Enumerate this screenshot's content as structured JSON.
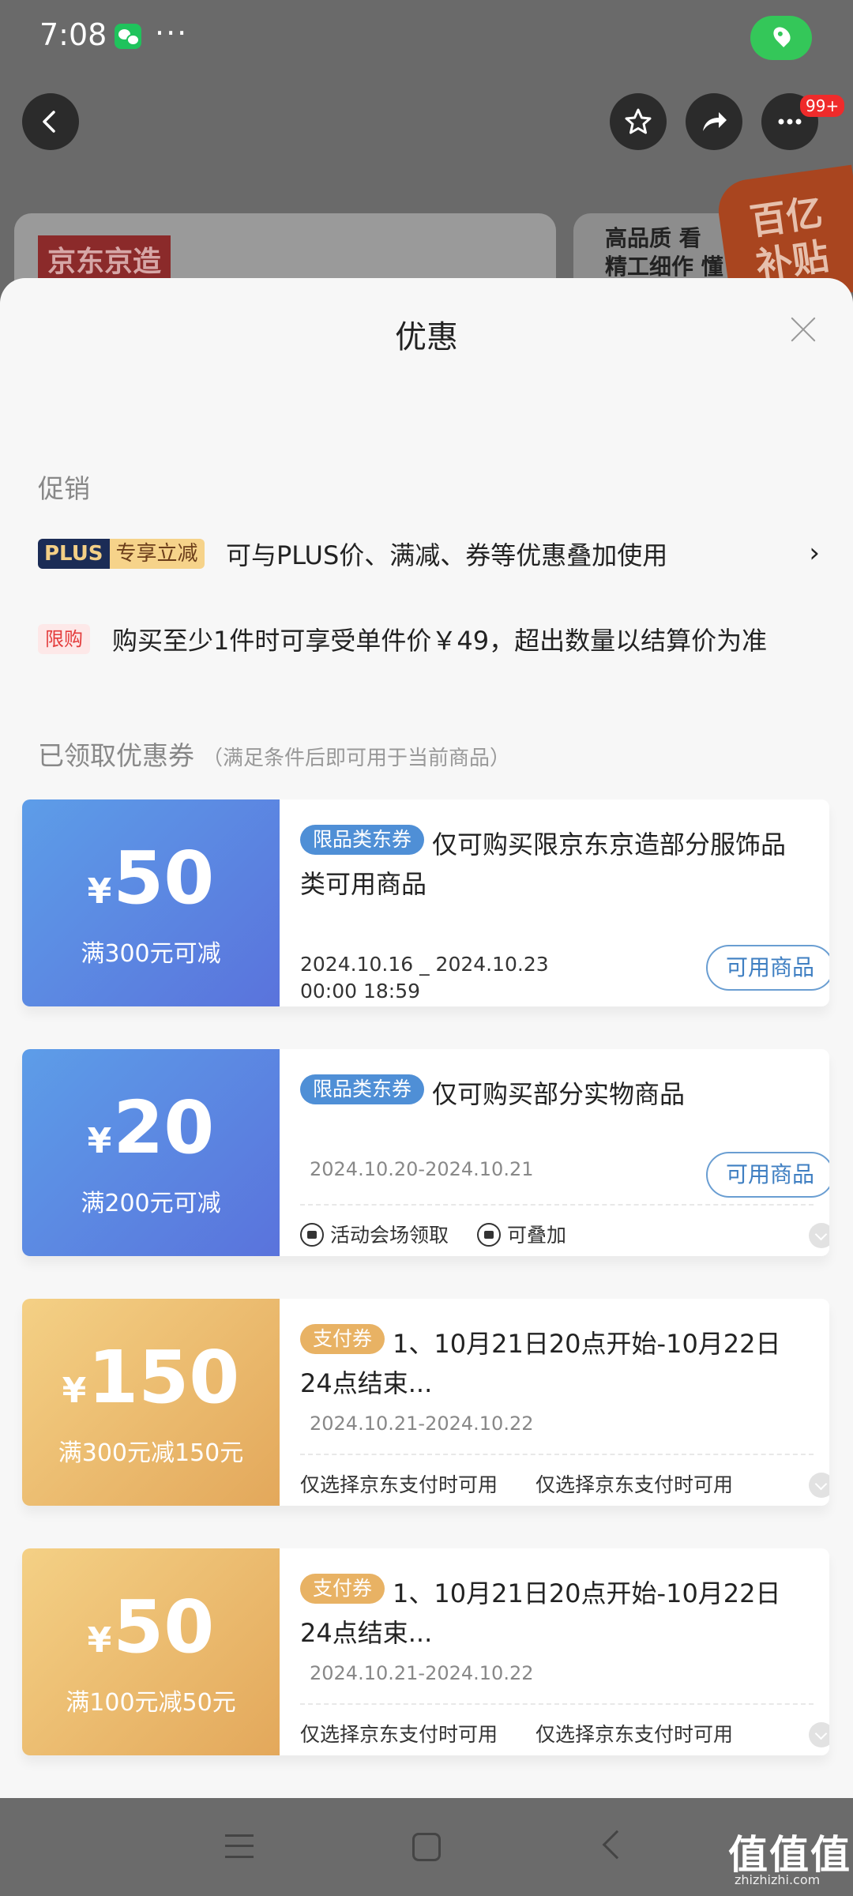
{
  "status_bar": {
    "time": "7:08",
    "more": "···",
    "wechat_icon": "wechat-icon",
    "location_icon": "location-icon"
  },
  "top_nav": {
    "badge": "99+"
  },
  "background": {
    "brand_logo": "京东京造",
    "promo_text": "高品质 看\n精工细作 懂",
    "subsidy_badge": "百亿\n补贴"
  },
  "sheet": {
    "title": "优惠",
    "promotions": {
      "title": "促销",
      "items": [
        {
          "tag_a": "PLUS",
          "tag_b": "专享立减",
          "text": "可与PLUS价、满减、券等优惠叠加使用"
        },
        {
          "tag": "限购",
          "text": "购买至少1件时可享受单件价￥49，超出数量以结算价为准"
        }
      ]
    },
    "coupons_section": {
      "title": "已领取优惠券",
      "subtitle": "（满足条件后即可用于当前商品）"
    },
    "coupons": [
      {
        "currency": "¥",
        "amount": "50",
        "condition": "满300元可减",
        "tag": "限品类东券",
        "desc": "仅可购买限京东京造部分服饰品类可用商品",
        "date_a": "2024.10.16 _ 2024.10.23",
        "date_b": "00:00 18:59",
        "button": "可用商品"
      },
      {
        "currency": "¥",
        "amount": "20",
        "condition": "满200元可减",
        "tag": "限品类东券",
        "desc": "仅可购买部分实物商品",
        "date": "2024.10.20-2024.10.21",
        "button": "可用商品",
        "feature1": "活动会场领取",
        "feature2": "可叠加"
      },
      {
        "currency": "¥",
        "amount": "150",
        "condition": "满300元减150元",
        "tag": "支付券",
        "desc": "1、10月21日20点开始-10月22日24点结束...",
        "date": "2024.10.21-2024.10.22",
        "feature1": "仅选择京东支付时可用",
        "feature2": "仅选择京东支付时可用"
      },
      {
        "currency": "¥",
        "amount": "50",
        "condition": "满100元减50元",
        "tag": "支付券",
        "desc": "1、10月21日20点开始-10月22日24点结束...",
        "date": "2024.10.21-2024.10.22",
        "feature1": "仅选择京东支付时可用",
        "feature2": "仅选择京东支付时可用"
      }
    ]
  },
  "watermark": {
    "main": "值值值",
    "sub": "zhizhizhi.com"
  }
}
